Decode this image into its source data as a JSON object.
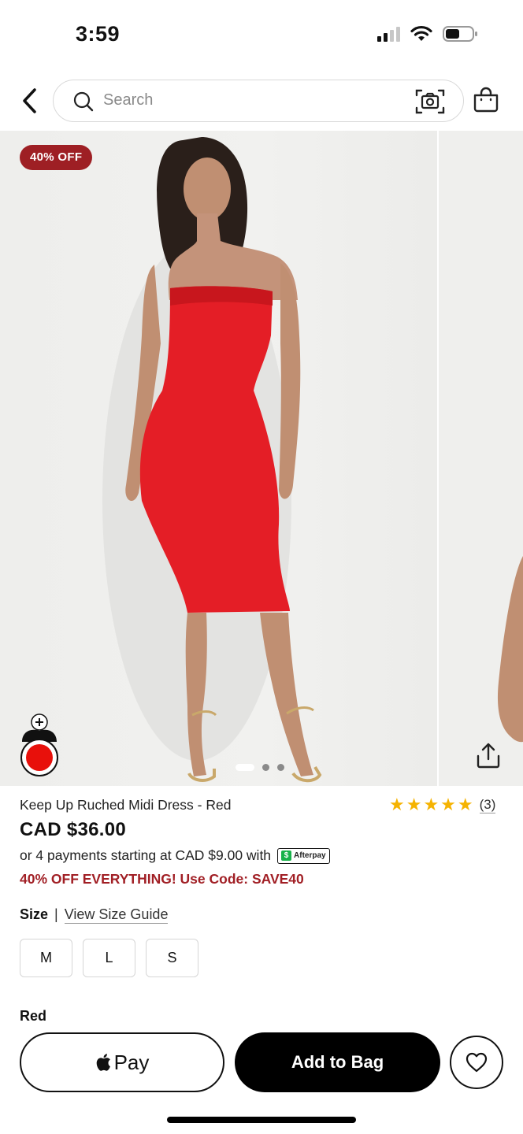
{
  "status_bar": {
    "time": "3:59"
  },
  "header": {
    "search_placeholder": "Search",
    "icons": [
      "chevron-left-icon",
      "search-icon",
      "camera-scan-icon",
      "shopping-bag-icon"
    ]
  },
  "gallery": {
    "badge": "40% OFF",
    "active_slide": 1,
    "slide_count": 3,
    "colors": {
      "dress": "#e41e26",
      "badge": "#9e1f24"
    }
  },
  "product": {
    "name": "Keep Up Ruched Midi Dress - Red",
    "rating_stars": "★★★★★",
    "rating_value": 5,
    "review_count": "(3)",
    "price": "CAD $36.00",
    "installments": "or 4 payments starting at CAD $9.00 with",
    "afterpay_label": "Afterpay",
    "promo": "40% OFF EVERYTHING! Use Code: SAVE40",
    "promo_color": "#a11f25"
  },
  "size": {
    "label": "Size",
    "separator": "|",
    "guide_link": "View Size Guide",
    "options": [
      "M",
      "L",
      "S"
    ]
  },
  "color": {
    "label": "Red"
  },
  "actions": {
    "apple_pay_label": "Pay",
    "add_to_bag_label": "Add to Bag"
  }
}
